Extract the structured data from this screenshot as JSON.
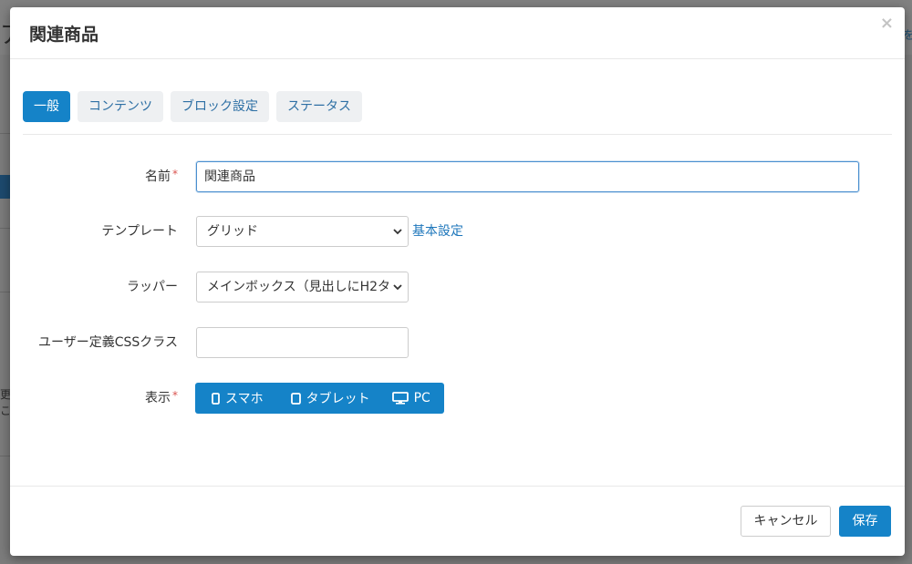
{
  "background": {
    "title_fragment": "ア",
    "right_fragment": "を",
    "side_fragments": [
      "更",
      "こ"
    ]
  },
  "modal": {
    "title": "関連商品",
    "close_glyph": "×"
  },
  "tabs": [
    {
      "label": "一般",
      "active": true
    },
    {
      "label": "コンテンツ",
      "active": false
    },
    {
      "label": "ブロック設定",
      "active": false
    },
    {
      "label": "ステータス",
      "active": false
    }
  ],
  "form": {
    "name": {
      "label": "名前",
      "required_mark": "*",
      "value": "関連商品"
    },
    "template": {
      "label": "テンプレート",
      "selected": "グリッド",
      "link": "基本設定"
    },
    "wrapper": {
      "label": "ラッパー",
      "selected": "メインボックス（見出しにH2タ"
    },
    "css_class": {
      "label": "ユーザー定義CSSクラス",
      "value": ""
    },
    "display": {
      "label": "表示",
      "required_mark": "*",
      "devices": [
        {
          "label": "スマホ",
          "icon": "mobile-icon"
        },
        {
          "label": "タブレット",
          "icon": "tablet-icon"
        },
        {
          "label": "PC",
          "icon": "desktop-icon"
        }
      ]
    }
  },
  "footer": {
    "cancel_label": "キャンセル",
    "save_label": "保存"
  },
  "colors": {
    "primary": "#1583c8",
    "link": "#1d76bb",
    "required": "#d9534f"
  }
}
